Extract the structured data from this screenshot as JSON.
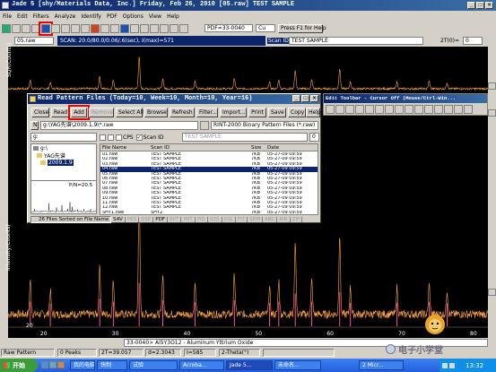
{
  "window": {
    "title": "Jade 5 [shy/Materials Data, Inc.] Friday, Feb 26, 2010 [05.raw] TEST SAMPLE",
    "menu": [
      "File",
      "Edit",
      "Filters",
      "Analyze",
      "Identify",
      "PDF",
      "Options",
      "View",
      "Help"
    ]
  },
  "toolbar": {
    "file_combo": "05.raw",
    "pdf_combo": "PDF=33-0040",
    "element_combo": "Cu",
    "help_hint": "Press F1 for Help",
    "scan_text": "SCAN: 20.0/80.0/0.06/.6(sec), I(max)=571",
    "scan_id_label": "Scan ID",
    "scan_id_value": "TEST SAMPLE",
    "two_theta_label": "2T(0)=",
    "two_theta_value": "0"
  },
  "top_plot": {
    "ylabel": "SQR(Counts)"
  },
  "main_plot": {
    "ylabel": "Intensity(Counts)",
    "x_ticks": [
      "20",
      "30",
      "40",
      "50",
      "60",
      "70",
      "80"
    ],
    "y_ticks": [
      "7",
      "5",
      "4",
      "3",
      "2",
      "1"
    ],
    "scale_label": "20"
  },
  "edit_toolbar": {
    "title": "Edit Toolbar - Cursor Off (Mouse/Ctrl-Win..."
  },
  "read_dialog": {
    "title": "Read Pattern Files (Today=10, Week=10, Month=10, Year=16)",
    "buttons": [
      "Close",
      "Read",
      "Add",
      "Remove",
      "Select All",
      "Browse",
      "Refresh",
      "Filter...",
      "Import...",
      "Print",
      "Save",
      "Copy",
      "Help"
    ],
    "path_prefix": "N",
    "path": "g:\\YAG先谱\\2009.1.9\\*.raw",
    "file_type": "RINT-2000 Binary Pattern Files (*.raw)",
    "drive": "g:",
    "cps_label": "CPS",
    "scan_id_label": "Scan ID",
    "scan_id_value": "TEST SAMPLE",
    "spin_value": "0",
    "folders": [
      "g:\\",
      "YAG先谱",
      "2009.1.9"
    ],
    "preview_label": "P/N=20.5",
    "columns": [
      "File Name",
      "Scan ID",
      "Size",
      "Date"
    ],
    "files": [
      {
        "name": "01.raw",
        "scan": "TEST SAMPLE",
        "size": "7KB",
        "date": "05-27-09 09:59"
      },
      {
        "name": "02.raw",
        "scan": "TEST SAMPLE",
        "size": "7KB",
        "date": "05-27-09 09:59"
      },
      {
        "name": "03.raw",
        "scan": "TEST SAMPLE",
        "size": "7KB",
        "date": "05-27-09 09:59"
      },
      {
        "name": "04.raw",
        "scan": "TEST SAMPLE",
        "size": "7KB",
        "date": "05-27-09 09:59"
      },
      {
        "name": "05.raw",
        "scan": "TEST SAMPLE",
        "size": "7KB",
        "date": "05-27-09 09:59"
      },
      {
        "name": "06.raw",
        "scan": "TEST SAMPLE",
        "size": "7KB",
        "date": "05-27-09 09:59"
      },
      {
        "name": "07.raw",
        "scan": "TEST SAMPLE",
        "size": "7KB",
        "date": "05-27-09 09:59"
      },
      {
        "name": "08.raw",
        "scan": "TEST SAMPLE",
        "size": "7KB",
        "date": "05-27-09 09:59"
      },
      {
        "name": "09.raw",
        "scan": "TEST SAMPLE",
        "size": "7KB",
        "date": "05-27-09 09:59"
      },
      {
        "name": "10.raw",
        "scan": "TEST SAMPLE",
        "size": "7KB",
        "date": "05-27-09 09:59"
      },
      {
        "name": "11.raw",
        "scan": "TEST SAMPLE",
        "size": "7KB",
        "date": "05-27-09 09:59"
      },
      {
        "name": "12.raw",
        "scan": "TEST SAMPLE",
        "size": "7KB",
        "date": "05-27-09 09:59"
      },
      {
        "name": "SHY1.raw",
        "scan": "SHY2",
        "size": "7KB",
        "date": "05-27-09 09:59"
      }
    ],
    "selected_index": 3,
    "status": "26 Files Sorted on File Name",
    "format_tabs": [
      "SAV",
      "PKS",
      "DSP",
      "PDF",
      "RPT",
      "PRT",
      "PID",
      "SZS",
      "XSL",
      "FIT",
      "SRM",
      "ABC",
      "RIR",
      "ZIP"
    ]
  },
  "pdf_bar": {
    "card": "33-0040> Al5Y3O12 - Aluminum Yttrium Oxide"
  },
  "status_bar": {
    "pattern": "Raw Pattern",
    "peaks": "0 Peaks",
    "two_theta": "2T=39.057",
    "d": "d=2.3043",
    "intensity": "I=585",
    "scale": "2-Theta(°)"
  },
  "watermark": "电子小学堂",
  "taskbar": {
    "start": "开始",
    "tasks": [
      "我的电脑",
      "快制",
      "试验",
      "Acroba...",
      "Jade 5...",
      "未命名...",
      "2 Micr..."
    ],
    "clock": "13:32"
  },
  "colors": {
    "background": "#000000",
    "spectrum": "#ffa640",
    "pdf_lines": "#ff4fa8",
    "dialog_face": "#d4d0c8",
    "title_blue": "#0a246a",
    "selection": "#0a246a"
  }
}
